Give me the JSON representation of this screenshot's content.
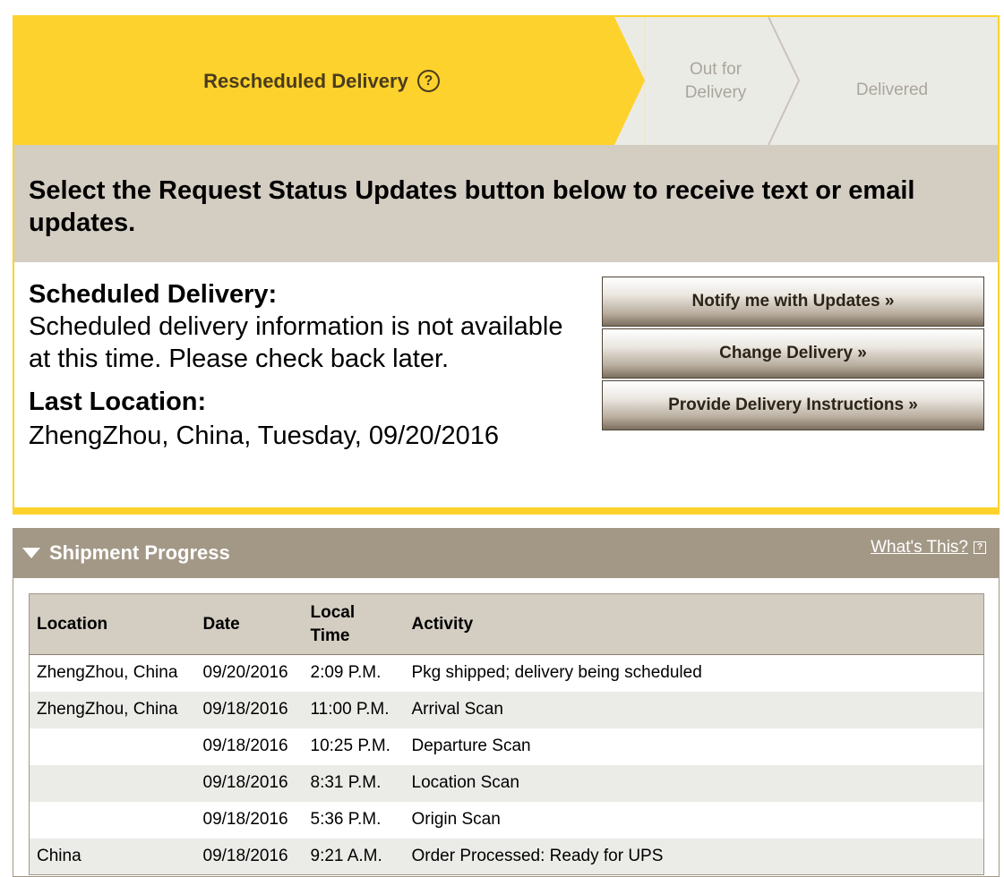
{
  "progress": {
    "current_step": "Rescheduled Delivery",
    "help_symbol": "?",
    "out_for_delivery_line1": "Out for",
    "out_for_delivery_line2": "Delivery",
    "delivered": "Delivered",
    "active_color": "#fdd22c",
    "inactive_color": "#ebebe6"
  },
  "banner": {
    "text": "Select the Request Status Updates button below to receive text or email updates."
  },
  "scheduled_delivery": {
    "heading": "Scheduled Delivery:",
    "text": "Scheduled delivery information is not available at this time. Please check back later."
  },
  "last_location": {
    "heading": "Last Location:",
    "text": "ZhengZhou, China, Tuesday, 09/20/2016"
  },
  "actions": {
    "notify_label": "Notify me with Updates »",
    "change_label": "Change Delivery »",
    "instructions_label": "Provide Delivery Instructions »"
  },
  "shipment_progress": {
    "title": "Shipment Progress",
    "whats_this": "What's This?",
    "help_symbol": "?",
    "columns": {
      "location": "Location",
      "date": "Date",
      "local_time_line1": "Local",
      "local_time_line2": "Time",
      "activity": "Activity"
    },
    "rows": [
      {
        "location": "ZhengZhou, China",
        "date": "09/20/2016",
        "time": "2:09 P.M.",
        "activity": "Pkg shipped; delivery being scheduled"
      },
      {
        "location": "ZhengZhou, China",
        "date": "09/18/2016",
        "time": "11:00 P.M.",
        "activity": "Arrival Scan"
      },
      {
        "location": "",
        "date": "09/18/2016",
        "time": "10:25 P.M.",
        "activity": "Departure Scan"
      },
      {
        "location": "",
        "date": "09/18/2016",
        "time": "8:31 P.M.",
        "activity": "Location Scan"
      },
      {
        "location": "",
        "date": "09/18/2016",
        "time": "5:36 P.M.",
        "activity": "Origin Scan"
      },
      {
        "location": "China",
        "date": "09/18/2016",
        "time": "9:21 A.M.",
        "activity": "Order Processed: Ready for UPS"
      }
    ]
  }
}
